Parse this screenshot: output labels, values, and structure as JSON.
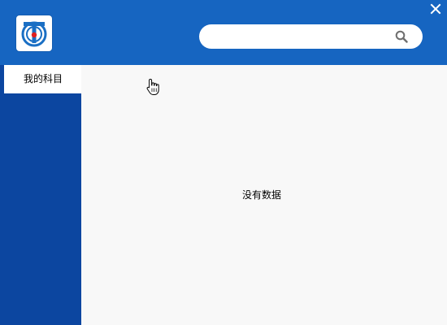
{
  "window": {
    "close_icon": "close-icon"
  },
  "header": {
    "logo_icon": "app-logo-icon",
    "search": {
      "value": "",
      "placeholder": "",
      "icon": "search-icon"
    }
  },
  "sidebar": {
    "items": [
      {
        "label": "我的科目",
        "selected": true
      }
    ]
  },
  "main": {
    "empty_message": "没有数据"
  },
  "colors": {
    "header_bg": "#1665c1",
    "sidebar_bg": "#0c46a0",
    "content_bg": "#f8f8f8",
    "logo_accent": "#1a6fc4",
    "logo_dot": "#e02020"
  }
}
